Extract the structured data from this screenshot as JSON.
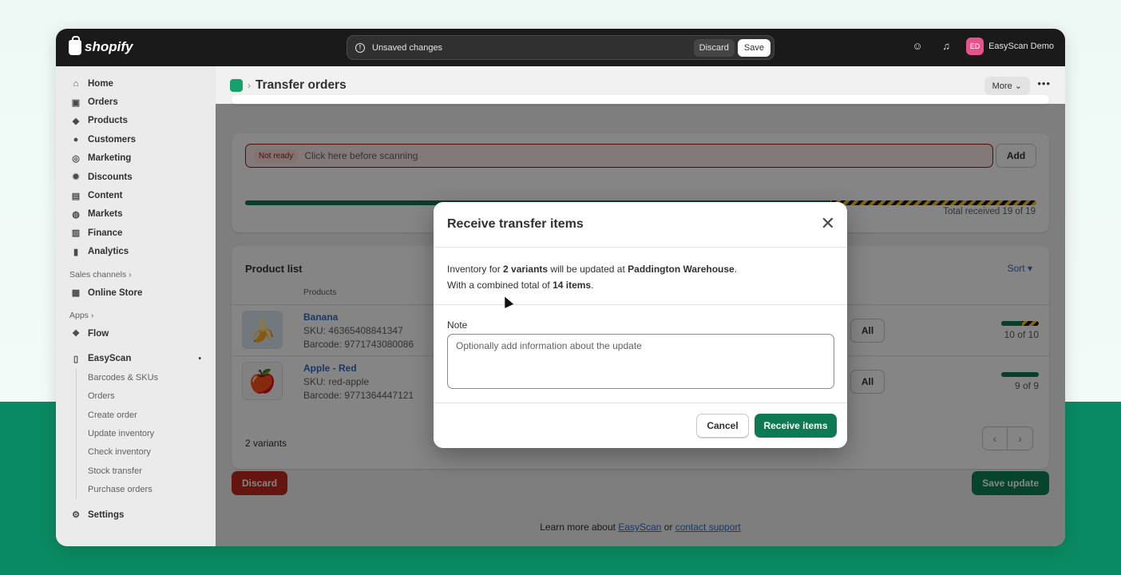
{
  "topbar": {
    "logo_text": "shopify",
    "unsaved_text": "Unsaved changes",
    "discard_label": "Discard",
    "save_label": "Save",
    "user_initials": "ED",
    "user_name": "EasyScan Demo"
  },
  "sidebar": {
    "items": [
      {
        "label": "Home",
        "icon": "home-icon",
        "glyph": "⌂"
      },
      {
        "label": "Orders",
        "icon": "orders-icon",
        "glyph": "▣"
      },
      {
        "label": "Products",
        "icon": "tag-icon",
        "glyph": "◆"
      },
      {
        "label": "Customers",
        "icon": "person-icon",
        "glyph": "●"
      },
      {
        "label": "Marketing",
        "icon": "target-icon",
        "glyph": "◎"
      },
      {
        "label": "Discounts",
        "icon": "discount-icon",
        "glyph": "✹"
      },
      {
        "label": "Content",
        "icon": "content-icon",
        "glyph": "▤"
      },
      {
        "label": "Markets",
        "icon": "globe-icon",
        "glyph": "◍"
      },
      {
        "label": "Finance",
        "icon": "bank-icon",
        "glyph": "▥"
      },
      {
        "label": "Analytics",
        "icon": "chart-icon",
        "glyph": "▮"
      }
    ],
    "sales_channels_label": "Sales channels",
    "online_store_label": "Online Store",
    "apps_label": "Apps",
    "flow_label": "Flow",
    "easyscan_label": "EasyScan",
    "easyscan_subitems": [
      "Barcodes & SKUs",
      "Orders",
      "Create order",
      "Update inventory",
      "Check inventory",
      "Stock transfer",
      "Purchase orders"
    ],
    "settings_label": "Settings"
  },
  "header": {
    "title": "Transfer orders",
    "more_label": "More",
    "more_dots": "•••"
  },
  "scan": {
    "status_badge": "Not ready",
    "placeholder": "Click here before scanning",
    "add_label": "Add",
    "progress_received_fraction": 0.74,
    "total_text": "Total received 19 of 19"
  },
  "product_list": {
    "title": "Product list",
    "sort_label": "Sort ▾",
    "column_products": "Products",
    "rows": [
      {
        "name": "Banana",
        "sku": "SKU: 46365408841347",
        "barcode": "Barcode: 9771743080086",
        "all_label": "All",
        "count_text": "10 of 10",
        "progress": 0.55,
        "image": "🍌"
      },
      {
        "name": "Apple - Red",
        "sku": "SKU: red-apple",
        "barcode": "Barcode: 9771364447121",
        "all_label": "All",
        "count_text": "9 of 9",
        "progress": 1.0,
        "image": "🍎"
      }
    ],
    "variants_text": "2 variants"
  },
  "actions": {
    "discard_label": "Discard",
    "save_update_label": "Save update"
  },
  "footer": {
    "text_before": "Learn more about ",
    "link1": "EasyScan",
    "text_mid": " or ",
    "link2": "contact support"
  },
  "modal": {
    "title": "Receive transfer items",
    "line1_pre": "Inventory for ",
    "line1_b1": "2 variants",
    "line1_mid": " will be updated at ",
    "line1_b2": "Paddington Warehouse",
    "line1_post": ".",
    "line2_pre": "With a combined total of ",
    "line2_b": "14 items",
    "line2_post": ".",
    "note_label": "Note",
    "note_placeholder": "Optionally add information about the update",
    "cancel_label": "Cancel",
    "receive_label": "Receive items"
  },
  "colors": {
    "accent_green": "#0d7a54",
    "danger_red": "#c0291d",
    "link_blue": "#2c6ecb"
  }
}
